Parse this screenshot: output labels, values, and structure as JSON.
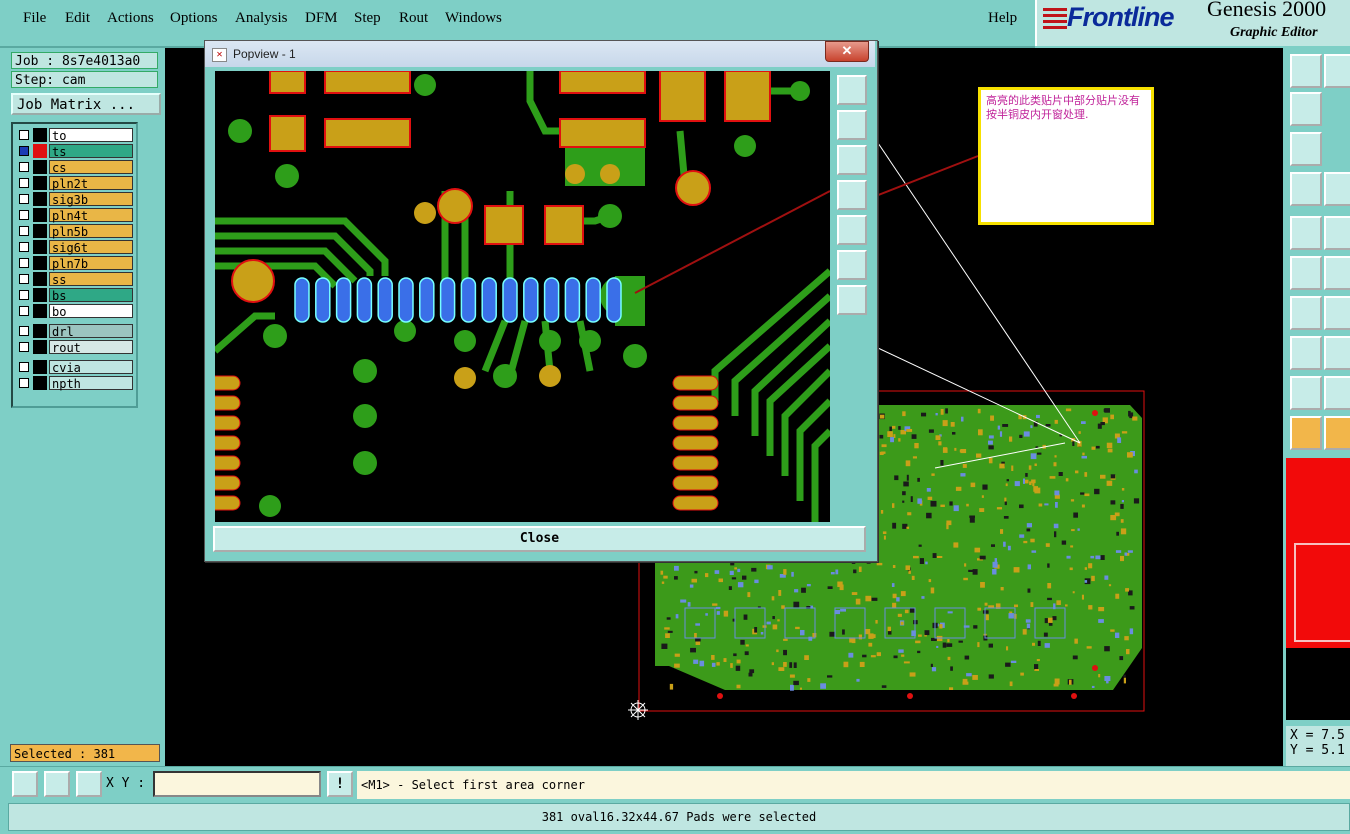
{
  "menu": {
    "items": [
      "File",
      "Edit",
      "Actions",
      "Options",
      "Analysis",
      "DFM",
      "Step",
      "Rout",
      "Windows"
    ],
    "help": "Help"
  },
  "brand": {
    "logo": "Frontline",
    "title": "Genesis 2000",
    "subtitle": "Graphic Editor"
  },
  "job": {
    "job_line": "Job : 8s7e4013a0",
    "step_line": "Step: cam",
    "matrix_button": "Job Matrix ..."
  },
  "layers": [
    {
      "name": "to",
      "color": "#ffffff",
      "selected": false
    },
    {
      "name": "ts",
      "color": "#2fa886",
      "selected": true
    },
    {
      "name": "cs",
      "color": "#e9b646",
      "selected": false
    },
    {
      "name": "pln2t",
      "color": "#e9b646",
      "selected": false
    },
    {
      "name": "sig3b",
      "color": "#e9b646",
      "selected": false
    },
    {
      "name": "pln4t",
      "color": "#e9b646",
      "selected": false
    },
    {
      "name": "pln5b",
      "color": "#e9b646",
      "selected": false
    },
    {
      "name": "sig6t",
      "color": "#e9b646",
      "selected": false
    },
    {
      "name": "pln7b",
      "color": "#e9b646",
      "selected": false
    },
    {
      "name": "ss",
      "color": "#e9b646",
      "selected": false
    },
    {
      "name": "bs",
      "color": "#2fa886",
      "selected": false
    },
    {
      "name": "bo",
      "color": "#ffffff",
      "selected": false
    }
  ],
  "drill_layers": [
    {
      "name": "drl",
      "color": "#9cc4c0"
    },
    {
      "name": "rout",
      "color": "#d6e8e6"
    }
  ],
  "via_layers": [
    {
      "name": "cvia",
      "color": "#bfe6e1"
    },
    {
      "name": "npth",
      "color": "#bfe6e1"
    }
  ],
  "selected_count": "Selected : 381",
  "coords": {
    "x": "X = 7.5",
    "y": "Y = 5.1"
  },
  "bottom": {
    "xy_label": "X Y :",
    "xy_value": "",
    "bang": "!",
    "prompt": "<M1> - Select first area corner"
  },
  "status": "381 oval16.32x44.67 Pads were selected",
  "popview": {
    "title": "Popview - 1",
    "close_x": "✕",
    "close_button": "Close"
  },
  "note": {
    "text": "高亮的此类贴片中部分贴片没有按半铜皮内开窗处理."
  },
  "colors": {
    "panel": "#7ecfc6",
    "copper_green": "#2e9e1a",
    "pad_gold": "#c9a018",
    "highlight_blue": "#3a6fe8",
    "board_outline_red": "#e01010"
  }
}
